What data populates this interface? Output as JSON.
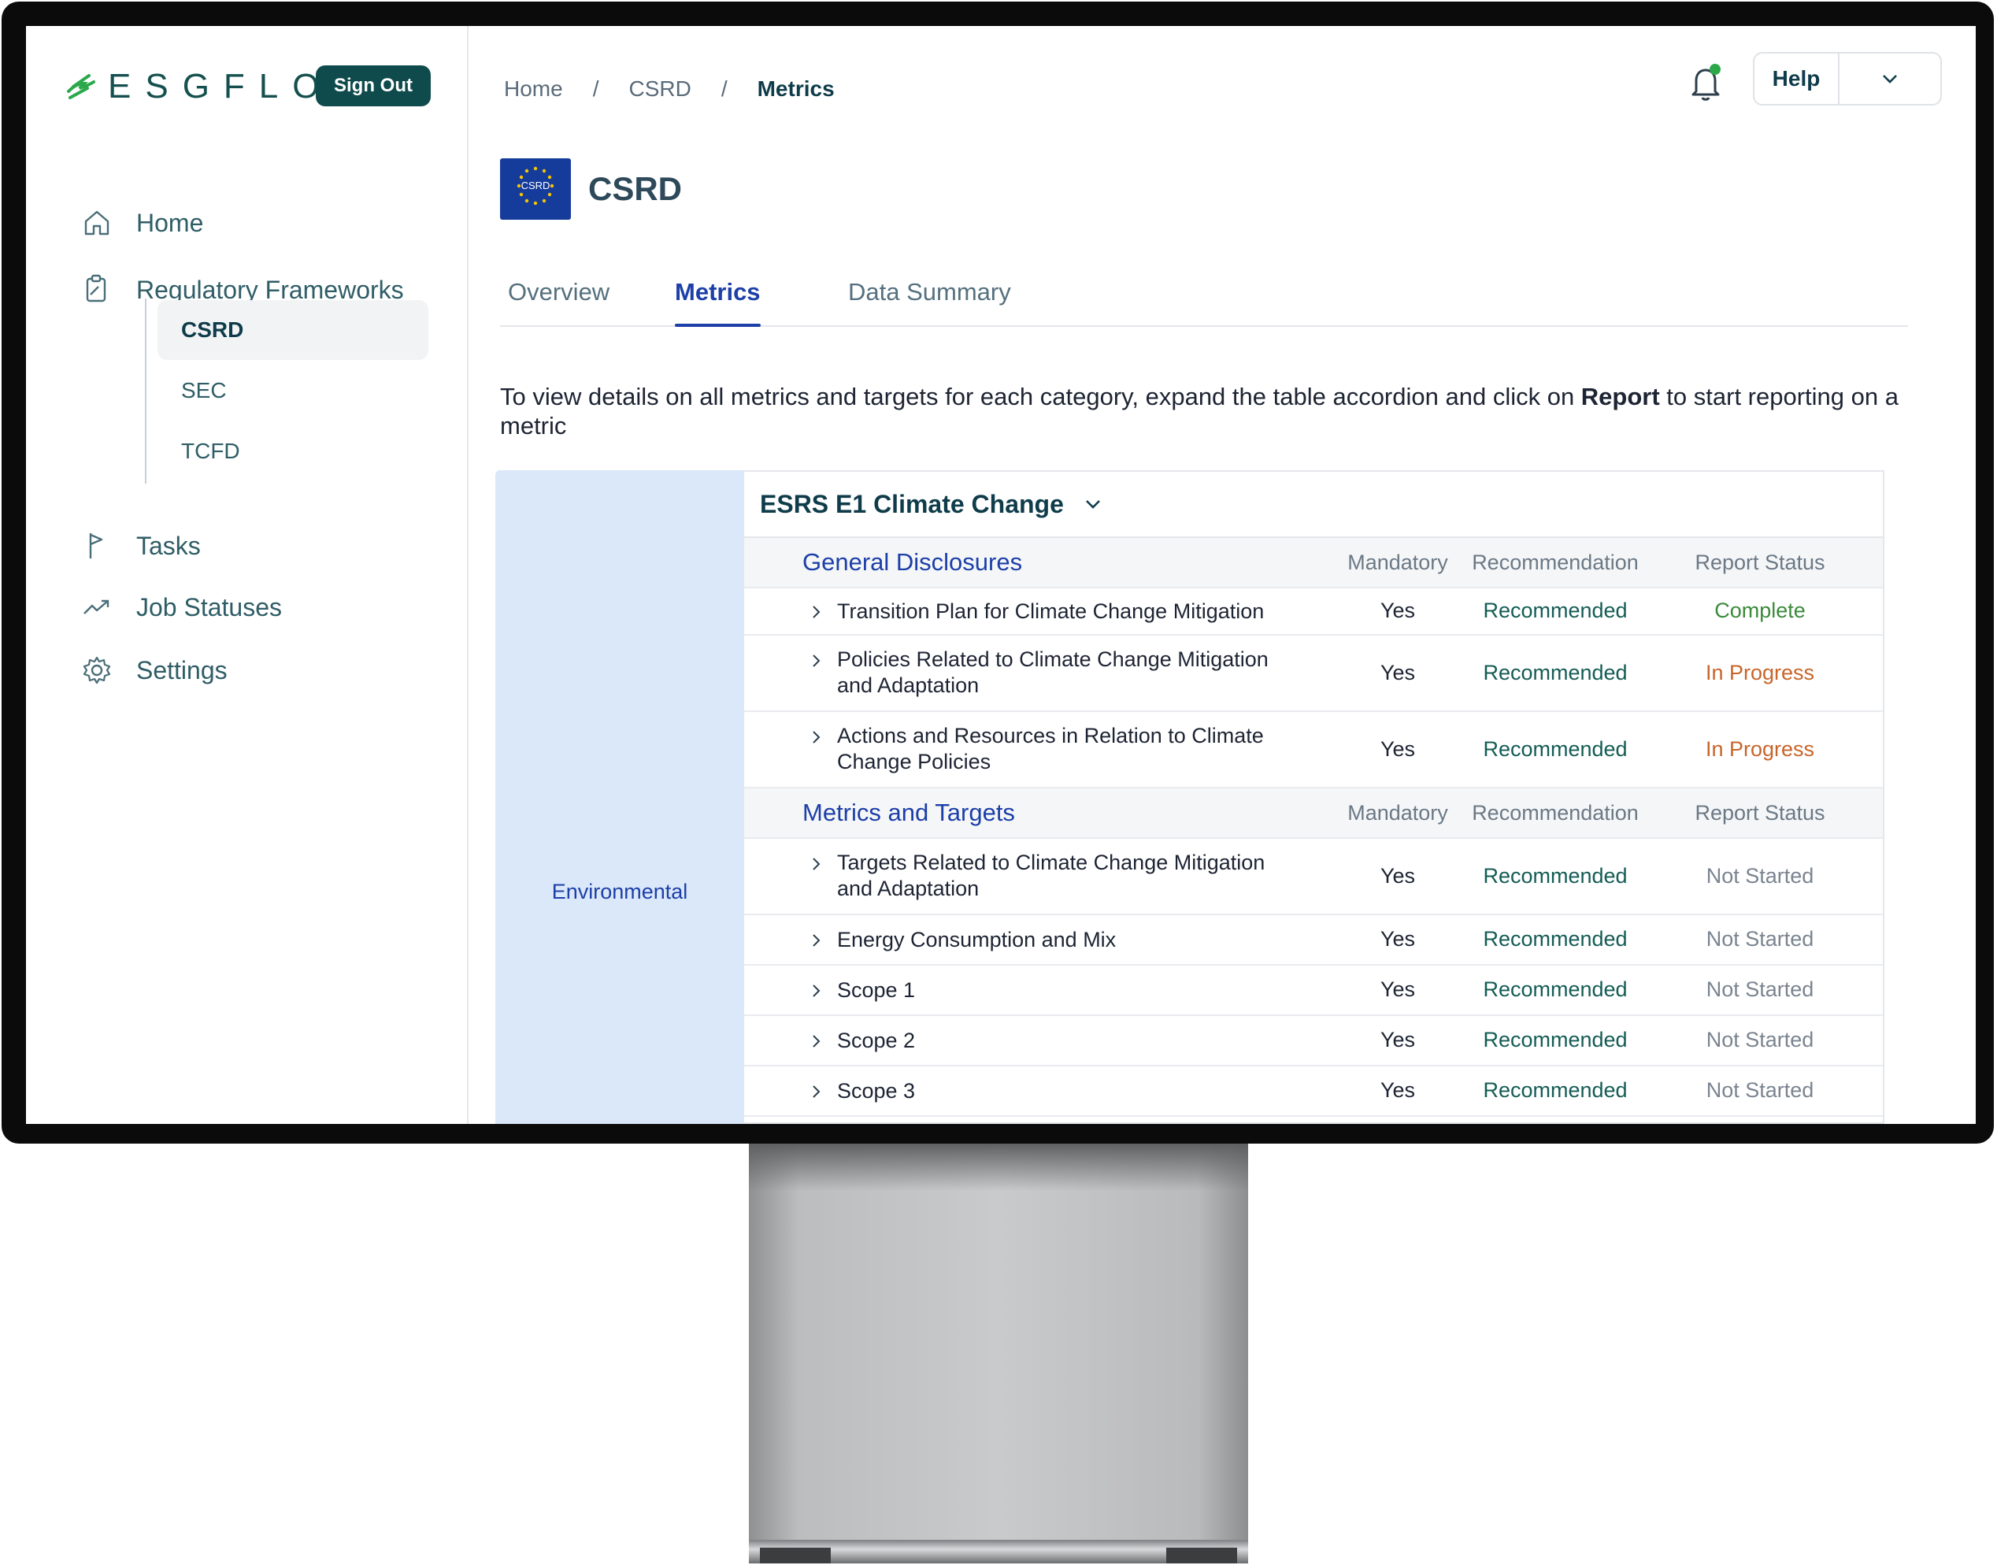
{
  "app": {
    "logo_text": "ESGFLO",
    "sign_out_label": "Sign Out"
  },
  "sidebar": {
    "items": [
      {
        "label": "Home",
        "icon": "home-icon"
      },
      {
        "label": "Regulatory Frameworks",
        "icon": "clipboard-icon"
      },
      {
        "label": "Tasks",
        "icon": "flag-icon"
      },
      {
        "label": "Job Statuses",
        "icon": "trend-icon"
      },
      {
        "label": "Settings",
        "icon": "gear-icon"
      }
    ],
    "frameworks": [
      {
        "label": "CSRD",
        "active": true
      },
      {
        "label": "SEC",
        "active": false
      },
      {
        "label": "TCFD",
        "active": false
      }
    ]
  },
  "header": {
    "breadcrumb": [
      "Home",
      "CSRD",
      "Metrics"
    ],
    "breadcrumb_sep": "/",
    "help_label": "Help"
  },
  "page": {
    "flag_label": "CSRD",
    "title": "CSRD",
    "tabs": [
      {
        "label": "Overview",
        "active": false
      },
      {
        "label": "Metrics",
        "active": true
      },
      {
        "label": "Data Summary",
        "active": false
      }
    ],
    "intro_before": "To view details on all metrics and targets for each category, expand the table accordion and click on ",
    "intro_bold": "Report",
    "intro_after": " to start reporting on a metric"
  },
  "table": {
    "category": "Environmental",
    "title": "ESRS E1 Climate Change",
    "columns": {
      "mandatory": "Mandatory",
      "recommendation": "Recommendation",
      "status": "Report Status"
    },
    "sections": [
      {
        "title": "General Disclosures",
        "rows": [
          {
            "name": "Transition Plan for Climate Change Mitigation",
            "mandatory": "Yes",
            "recommendation": "Recommended",
            "status": "Complete"
          },
          {
            "name": "Policies Related to Climate Change Mitigation and Adaptation",
            "mandatory": "Yes",
            "recommendation": "Recommended",
            "status": "In Progress"
          },
          {
            "name": "Actions and Resources in Relation to Climate Change Policies",
            "mandatory": "Yes",
            "recommendation": "Recommended",
            "status": "In Progress"
          }
        ]
      },
      {
        "title": "Metrics and Targets",
        "rows": [
          {
            "name": "Targets Related to Climate Change Mitigation and Adaptation",
            "mandatory": "Yes",
            "recommendation": "Recommended",
            "status": "Not Started"
          },
          {
            "name": "Energy Consumption and Mix",
            "mandatory": "Yes",
            "recommendation": "Recommended",
            "status": "Not Started"
          },
          {
            "name": "Scope 1",
            "mandatory": "Yes",
            "recommendation": "Recommended",
            "status": "Not Started"
          },
          {
            "name": "Scope 2",
            "mandatory": "Yes",
            "recommendation": "Recommended",
            "status": "Not Started"
          },
          {
            "name": "Scope 3",
            "mandatory": "Yes",
            "recommendation": "Recommended",
            "status": "Not Started"
          }
        ]
      }
    ]
  },
  "colors": {
    "brand": "#0f4a4c",
    "accent": "#1c3fa8",
    "complete": "#3b8a3a",
    "in_progress": "#c8652a",
    "not_started": "#7a8490"
  }
}
